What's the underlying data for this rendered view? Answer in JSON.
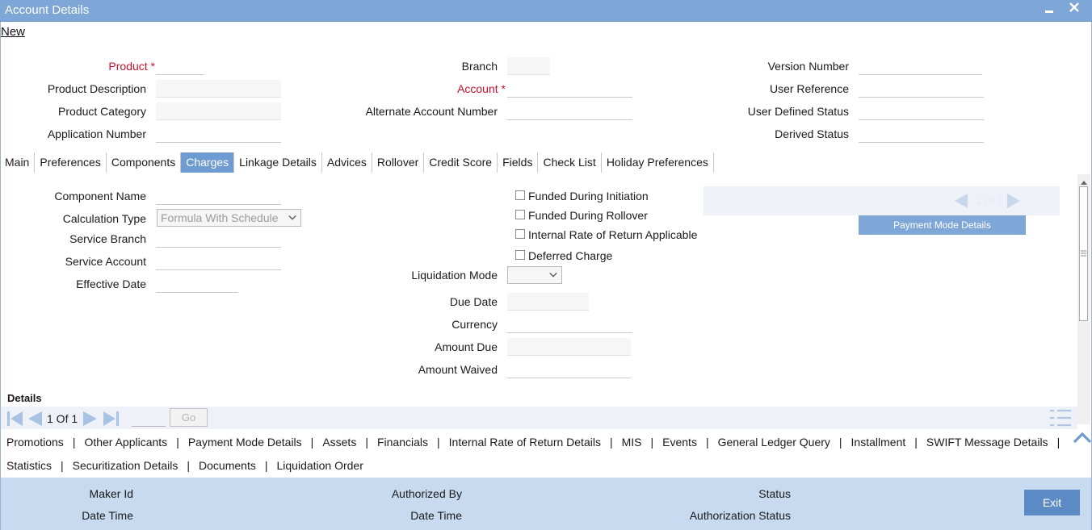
{
  "window": {
    "title": "Account Details",
    "minimize": "▬",
    "close": "✕"
  },
  "toolbar": {
    "new_label": "New"
  },
  "header": {
    "product_label": "Product",
    "product_description_label": "Product Description",
    "product_category_label": "Product Category",
    "application_number_label": "Application Number",
    "branch_label": "Branch",
    "account_label": "Account",
    "alternate_account_label": "Alternate Account Number",
    "version_number_label": "Version Number",
    "user_reference_label": "User Reference",
    "user_defined_status_label": "User Defined Status",
    "derived_status_label": "Derived Status",
    "required_mark": "*"
  },
  "tabs": [
    "Main",
    "Preferences",
    "Components",
    "Charges",
    "Linkage Details",
    "Advices",
    "Rollover",
    "Credit Score",
    "Fields",
    "Check List",
    "Holiday Preferences"
  ],
  "active_tab": "Charges",
  "charges": {
    "component_name_label": "Component Name",
    "calculation_type_label": "Calculation Type",
    "calculation_type_value": "Formula With Schedule",
    "service_branch_label": "Service Branch",
    "service_account_label": "Service Account",
    "effective_date_label": "Effective Date",
    "funded_during_initiation": "Funded During Initiation",
    "funded_during_rollover": "Funded During Rollover",
    "irr_applicable": "Internal Rate of Return Applicable",
    "deferred_charge": "Deferred Charge",
    "liquidation_mode_label": "Liquidation Mode",
    "due_date_label": "Due Date",
    "currency_label": "Currency",
    "amount_due_label": "Amount Due",
    "amount_waived_label": "Amount Waived",
    "pager_text": "1 Of 1",
    "payment_mode_details_button": "Payment Mode Details"
  },
  "details": {
    "title": "Details",
    "page_text": "1 Of 1",
    "go_button": "Go"
  },
  "sublinks_row1": [
    "Promotions",
    "Other Applicants",
    "Payment Mode Details",
    "Assets",
    "Financials",
    "Internal Rate of Return Details",
    "MIS",
    "Events",
    "General Ledger Query",
    "Installment",
    "SWIFT Message Details"
  ],
  "sublinks_row2": [
    "Statistics",
    "Securitization Details",
    "Documents",
    "Liquidation Order"
  ],
  "separator": "|",
  "footer": {
    "maker_id": "Maker Id",
    "date_time_1": "Date Time",
    "authorized_by": "Authorized By",
    "date_time_2": "Date Time",
    "status": "Status",
    "authorization_status": "Authorization Status",
    "exit_button": "Exit"
  },
  "colors": {
    "accent": "#7ea6d6",
    "required": "#c8102e",
    "footer": "#c7daf0"
  }
}
